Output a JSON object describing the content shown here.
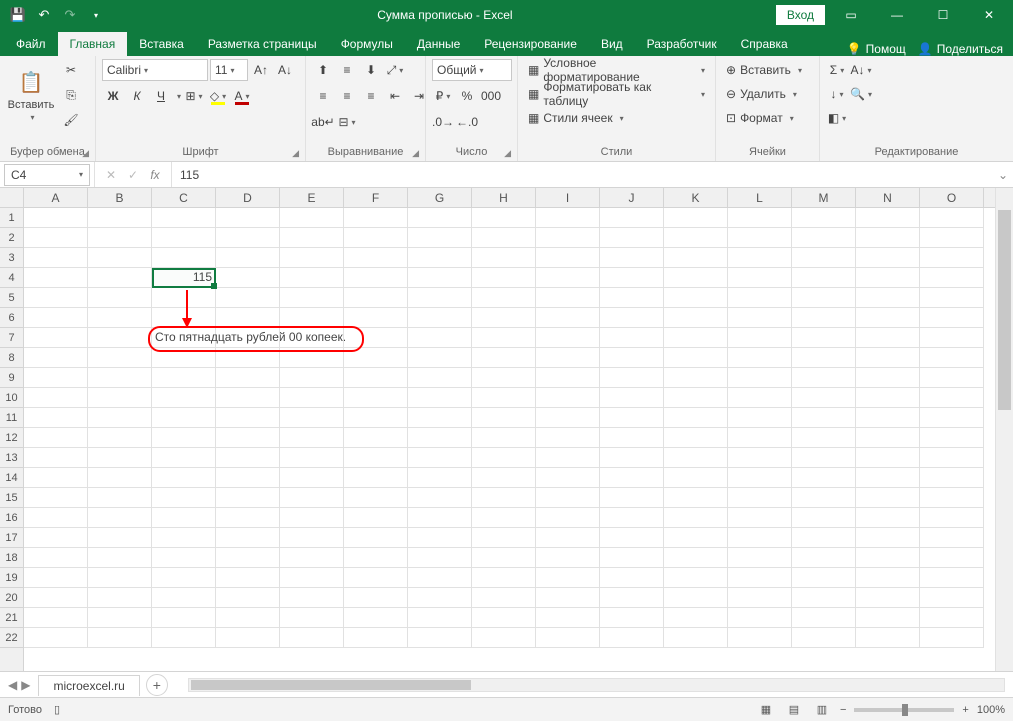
{
  "titlebar": {
    "title": "Сумма прописью - Excel",
    "login": "Вход"
  },
  "tabs": {
    "file": "Файл",
    "home": "Главная",
    "insert": "Вставка",
    "layout": "Разметка страницы",
    "formulas": "Формулы",
    "data": "Данные",
    "review": "Рецензирование",
    "view": "Вид",
    "developer": "Разработчик",
    "help": "Справка",
    "tell_me": "Помощ",
    "share": "Поделиться"
  },
  "ribbon": {
    "clipboard": {
      "label": "Буфер обмена",
      "paste": "Вставить"
    },
    "font": {
      "label": "Шрифт",
      "name": "Calibri",
      "size": "11",
      "bold": "Ж",
      "italic": "К",
      "underline": "Ч"
    },
    "alignment": {
      "label": "Выравнивание"
    },
    "number": {
      "label": "Число",
      "format": "Общий"
    },
    "styles": {
      "label": "Стили",
      "cond": "Условное форматирование",
      "table": "Форматировать как таблицу",
      "cell": "Стили ячеек"
    },
    "cells": {
      "label": "Ячейки",
      "insert": "Вставить",
      "delete": "Удалить",
      "format": "Формат"
    },
    "editing": {
      "label": "Редактирование"
    }
  },
  "namebox": "C4",
  "formula": "115",
  "columns": [
    "A",
    "B",
    "C",
    "D",
    "E",
    "F",
    "G",
    "H",
    "I",
    "J",
    "K",
    "L",
    "M",
    "N",
    "O"
  ],
  "rows": 22,
  "cell_c4": "115",
  "cell_c7": "Сто пятнадцать рублей 00 копеек.",
  "sheet": {
    "name": "microexcel.ru"
  },
  "status": {
    "ready": "Готово",
    "zoom": "100%"
  }
}
